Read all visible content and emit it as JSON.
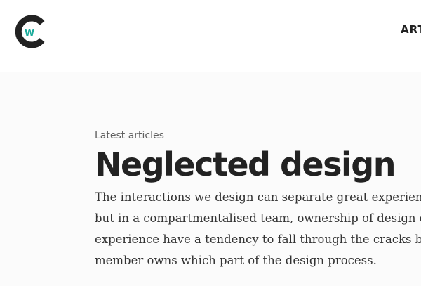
{
  "header": {
    "logo": {
      "icon": "cw-logo-icon",
      "letter": "W",
      "ring_color": "#222222",
      "accent_color": "#1aab9b"
    },
    "nav": {
      "items": [
        {
          "label": "ART"
        }
      ]
    }
  },
  "main": {
    "eyebrow": "Latest articles",
    "title": "Neglected design",
    "body_lines": [
      "The interactions we design can separate great experience",
      "but in a compartmentalised team, ownership of design de",
      "experience have a tendency to fall through the cracks bet",
      "member owns which part of the design process."
    ]
  }
}
